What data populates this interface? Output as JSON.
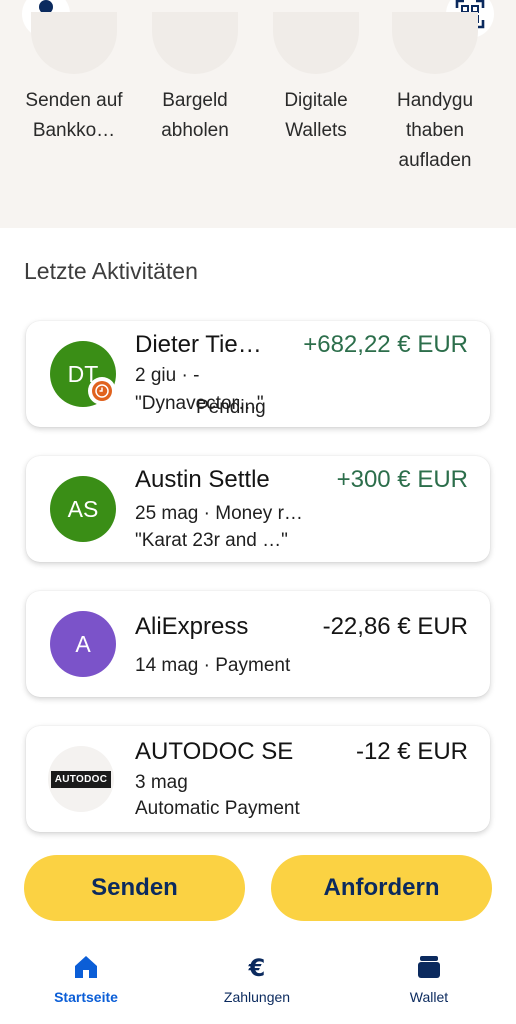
{
  "colors": {
    "accent_blue": "#0b5ed7",
    "navy": "#0b2a5e",
    "positive_green": "#2c6e4b",
    "button_yellow": "#fbd243"
  },
  "header": {
    "profile_icon": "person-icon",
    "qr_icon": "qr-scan-icon"
  },
  "quick_actions": [
    {
      "label": "Senden auf Bankko…"
    },
    {
      "label": "Bargeld abholen"
    },
    {
      "label": "Digitale Wallets"
    },
    {
      "label": "Handygu thaben aufladen"
    }
  ],
  "activity": {
    "title": "Letzte Aktivitäten",
    "items": [
      {
        "initials": "DT",
        "name": "Dieter Tie…",
        "amount": "+682,22 € EUR",
        "line1": "2 giu · -",
        "line2": "\"Dynavector…\"",
        "status": "Pending",
        "avatar_color": "#3a8e16",
        "status_icon": "clock-icon"
      },
      {
        "initials": "AS",
        "name": "Austin Settle",
        "amount": "+300 € EUR",
        "line1": "25 mag · Money r…",
        "line2": "\"Karat 23r and …\"",
        "avatar_color": "#3a8e16"
      },
      {
        "initials": "A",
        "name": "AliExpress",
        "amount": "-22,86 € EUR",
        "line1": "14 mag · Payment",
        "avatar_color": "#7b53c9"
      },
      {
        "name": "AUTODOC SE",
        "amount": "-12 € EUR",
        "line1": "3 mag",
        "line2": "Automatic Payment",
        "logo_text": "AUTODOC"
      }
    ]
  },
  "actions": {
    "send": "Senden",
    "request": "Anfordern"
  },
  "tabs": [
    {
      "label": "Startseite",
      "icon": "home-icon",
      "active": true
    },
    {
      "label": "Zahlungen",
      "icon": "euro-icon",
      "active": false
    },
    {
      "label": "Wallet",
      "icon": "wallet-icon",
      "active": false
    }
  ]
}
